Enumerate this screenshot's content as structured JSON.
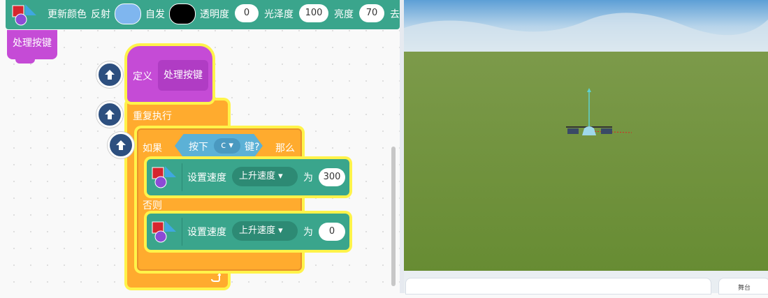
{
  "top_block": {
    "label_update_color": "更新颜色",
    "label_reflect": "反射",
    "reflect_color": "#7fb6ef",
    "label_emissive": "自发",
    "emissive_color": "#000000",
    "label_opacity": "透明度",
    "opacity_value": "0",
    "label_gloss": "光泽度",
    "gloss_value": "100",
    "label_brightness": "亮度",
    "brightness_value": "70",
    "label_trailing": "去"
  },
  "handle_block": {
    "label": "处理按键"
  },
  "define_block": {
    "label": "定义",
    "name": "处理按键"
  },
  "repeat_block": {
    "label": "重复执行"
  },
  "if_block": {
    "label_if": "如果",
    "label_else": "否则",
    "label_then": "那么",
    "condition": {
      "prefix": "按下",
      "key": "c",
      "suffix": "键?"
    }
  },
  "set_speed_1": {
    "label": "设置速度",
    "dropdown": "上升速度",
    "to": "为",
    "value": "300"
  },
  "set_speed_2": {
    "label": "设置速度",
    "dropdown": "上升速度",
    "to": "为",
    "value": "0"
  },
  "stage": {
    "sky_top": "#5d9fd6",
    "ground": "#6d9238"
  },
  "stage_panel": {
    "tab_label": "舞台"
  }
}
